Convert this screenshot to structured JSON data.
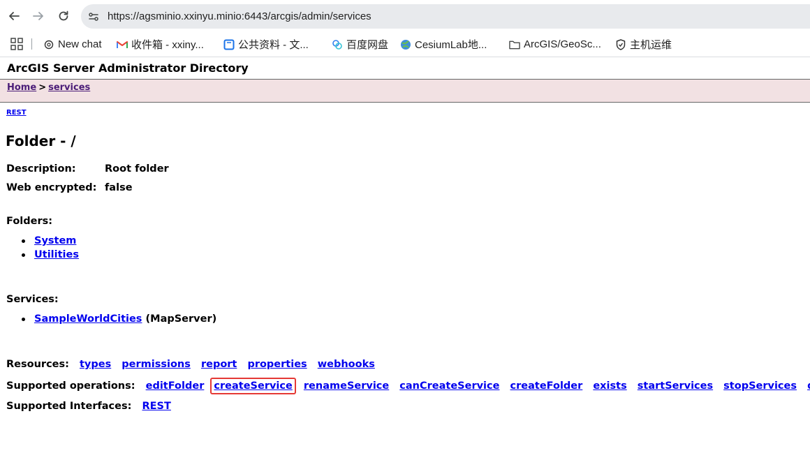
{
  "browser": {
    "url": "https://agsminio.xxinyu.minio:6443/arcgis/admin/services",
    "bookmarks": [
      {
        "label": "New chat",
        "icon": "openai-icon"
      },
      {
        "label": "收件箱 - xxiny...",
        "icon": "gmail-icon"
      },
      {
        "label": "公共资料 - 文...",
        "icon": "doc-icon"
      },
      {
        "label": "百度网盘",
        "icon": "baidu-netdisk-icon"
      },
      {
        "label": "CesiumLab地...",
        "icon": "globe-icon"
      },
      {
        "label": "ArcGIS/GeoSc...",
        "icon": "folder-icon"
      },
      {
        "label": "主机运维",
        "icon": "shield-icon"
      }
    ]
  },
  "page": {
    "header_title": "ArcGIS Server Administrator Directory",
    "breadcrumb": {
      "home": "Home",
      "sep": ">",
      "current": "services"
    },
    "rest_link": "REST",
    "folder_title": "Folder - /",
    "properties": [
      {
        "label": "Description:",
        "value": "Root folder"
      },
      {
        "label": "Web encrypted:",
        "value": "false"
      }
    ],
    "folders_label": "Folders:",
    "folders": [
      "System",
      "Utilities"
    ],
    "services_label": "Services:",
    "services": [
      {
        "name": "SampleWorldCities",
        "type": "(MapServer)"
      }
    ],
    "resources_label": "Resources:",
    "resources": [
      "types",
      "permissions",
      "report",
      "properties",
      "webhooks"
    ],
    "operations_label": "Supported operations:",
    "operations": [
      "editFolder",
      "createService",
      "renameService",
      "canCreateService",
      "createFolder",
      "exists",
      "startServices",
      "stopServices",
      "delet"
    ],
    "highlighted_operation": "createService",
    "interfaces_label": "Supported Interfaces:",
    "interfaces": [
      "REST"
    ]
  }
}
